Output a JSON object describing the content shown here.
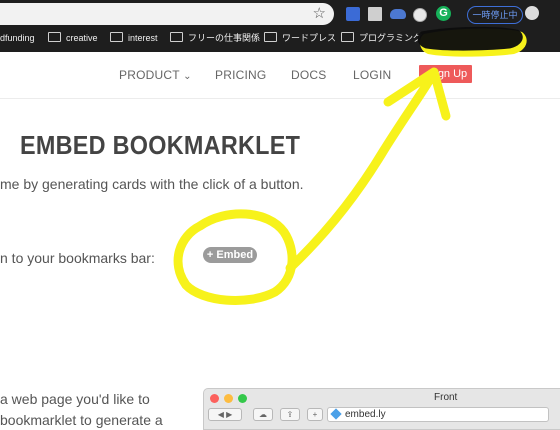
{
  "browser": {
    "pause_label": "一時停止中",
    "bookmarks": [
      {
        "label": "dfunding",
        "folder": false
      },
      {
        "label": "creative",
        "folder": true
      },
      {
        "label": "interest",
        "folder": true
      },
      {
        "label": "フリーの仕事関係",
        "folder": true
      },
      {
        "label": "ワードプレス",
        "folder": true
      },
      {
        "label": "プログラミング",
        "folder": true
      }
    ]
  },
  "nav": {
    "product": "PRODUCT",
    "product_caret": "⌄",
    "pricing": "PRICING",
    "docs": "DOCS",
    "login": "LOGIN",
    "signup": "gn Up"
  },
  "content": {
    "title": "EMBED BOOKMARKLET",
    "intro": "me by generating cards with the click of a button.",
    "drag_text": "n to your bookmarks bar:",
    "embed_button": "+ Embed",
    "howto_line1": "a web page you'd like to",
    "howto_line2": "bookmarklet to generate a"
  },
  "mini_window": {
    "title": "Front",
    "address": "embed.ly"
  },
  "colors": {
    "chrome_bg": "#1e1e1e",
    "signup_bg": "#ee5a5a",
    "highlighter": "#f7f21b",
    "embed_pill": "#9b9b9b",
    "text": "#555555"
  }
}
